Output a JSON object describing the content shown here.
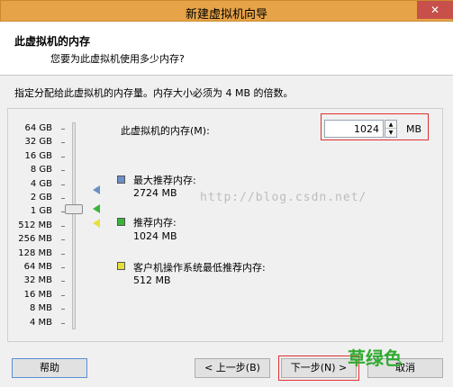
{
  "window": {
    "title": "新建虚拟机向导",
    "close_glyph": "✕"
  },
  "header": {
    "title": "此虚拟机的内存",
    "subtitle": "您要为此虚拟机使用多少内存?"
  },
  "instruction": "指定分配给此虚拟机的内存量。内存大小必须为 4 MB 的倍数。",
  "memory": {
    "label": "此虚拟机的内存(M):",
    "value": "1024",
    "unit": "MB"
  },
  "scale": [
    "64 GB",
    "32 GB",
    "16 GB",
    "8 GB",
    "4 GB",
    "2 GB",
    "1 GB",
    "512 MB",
    "256 MB",
    "128 MB",
    "64 MB",
    "32 MB",
    "16 MB",
    "8 MB",
    "4 MB"
  ],
  "legend": {
    "max": {
      "title": "最大推荐内存:",
      "value": "2724 MB",
      "color": "#6c8fc8"
    },
    "recommended": {
      "title": "推荐内存:",
      "value": "1024 MB",
      "color": "#3ab53a"
    },
    "min": {
      "title": "客户机操作系统最低推荐内存:",
      "value": "512 MB",
      "color": "#e6e03a"
    }
  },
  "watermark": "http://blog.csdn.net/",
  "buttons": {
    "help": "帮助",
    "back": "< 上一步(B)",
    "next": "下一步(N) >",
    "cancel": "取消"
  },
  "overlay_text": "草绿色"
}
